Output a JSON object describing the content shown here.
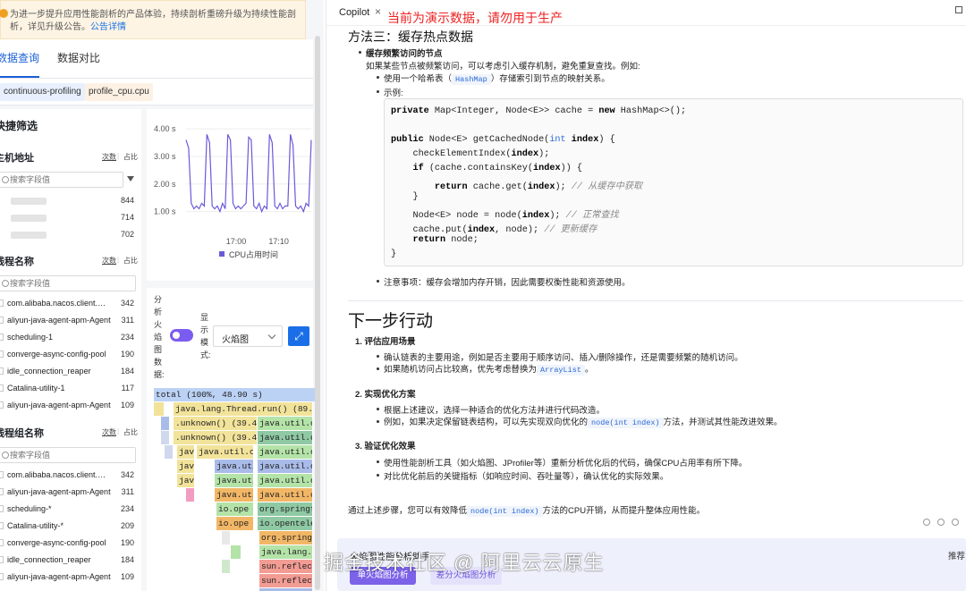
{
  "notice": {
    "text": "为进一步提升应用性能剖析的产品体验，持续剖析重磅升级为持续性能剖析，详见升级公告。",
    "link": "公告详情"
  },
  "tabs": {
    "query": "数据查询",
    "compare": "数据对比"
  },
  "file_tags": [
    "continuous-profiling",
    "profile_cpu.cpu"
  ],
  "filter": {
    "title": "快捷筛选",
    "host": {
      "title": "主机地址",
      "toggle_count": "次数",
      "toggle_share": "占比",
      "placeholder": "搜索字段值",
      "rows": [
        {
          "name": "",
          "count": "844"
        },
        {
          "name": "",
          "count": "714"
        },
        {
          "name": "",
          "count": "702"
        }
      ]
    },
    "thread": {
      "title": "线程名称",
      "toggle_count": "次数",
      "toggle_share": "占比",
      "placeholder": "搜索字段值",
      "rows": [
        {
          "name": "com.alibaba.nacos.client.Worker",
          "count": "342"
        },
        {
          "name": "aliyun-java-agent-apm-Agent",
          "count": "311"
        },
        {
          "name": "scheduling-1",
          "count": "234"
        },
        {
          "name": "converge-async-config-pool",
          "count": "190"
        },
        {
          "name": "idle_connection_reaper",
          "count": "184"
        },
        {
          "name": "Catalina-utility-1",
          "count": "117"
        },
        {
          "name": "aliyun-java-agent-apm-Agent",
          "count": "109"
        }
      ]
    },
    "thread_group": {
      "title": "线程组名称",
      "toggle_count": "次数",
      "toggle_share": "占比",
      "placeholder": "搜索字段值",
      "rows": [
        {
          "name": "com.alibaba.nacos.client.Worker",
          "count": "342"
        },
        {
          "name": "aliyun-java-agent-apm-Agent",
          "count": "311"
        },
        {
          "name": "scheduling-*",
          "count": "234"
        },
        {
          "name": "Catalina-utility-*",
          "count": "209"
        },
        {
          "name": "converge-async-config-pool",
          "count": "190"
        },
        {
          "name": "idle_connection_reaper",
          "count": "184"
        },
        {
          "name": "aliyun-java-agent-apm-Agent",
          "count": "109"
        }
      ]
    }
  },
  "chart_data": {
    "type": "line",
    "title": "",
    "xlabel": "",
    "ylabel": "",
    "y_ticks": [
      "4.00 s",
      "3.00 s",
      "2.00 s",
      "1.00 s"
    ],
    "x_ticks": [
      "17:00",
      "17:10"
    ],
    "ylim": [
      0.5,
      4.2
    ],
    "x": [
      0,
      1,
      2,
      3,
      4,
      5,
      6,
      7,
      8,
      9,
      10,
      11,
      12,
      13,
      14,
      15,
      16,
      17,
      18,
      19,
      20,
      21,
      22,
      23,
      24,
      25,
      26,
      27,
      28,
      29,
      30,
      31,
      32,
      33,
      34,
      35,
      36,
      37,
      38,
      39,
      40,
      41,
      42,
      43,
      44,
      45,
      46,
      47,
      48
    ],
    "series": [
      {
        "name": "CPU占用时间",
        "color": "#6a5ad8",
        "values": [
          3.6,
          3.3,
          1.3,
          1.1,
          1.2,
          1.1,
          1.3,
          1.2,
          3.8,
          3.5,
          1.2,
          1.1,
          1.2,
          1.0,
          1.3,
          1.1,
          3.8,
          3.6,
          1.3,
          1.1,
          1.2,
          1.1,
          1.2,
          1.3,
          3.7,
          3.6,
          1.2,
          1.1,
          1.3,
          1.0,
          1.2,
          1.1,
          3.8,
          3.5,
          1.2,
          1.1,
          1.3,
          1.1,
          1.2,
          1.2,
          3.8,
          3.4,
          1.2,
          1.1,
          1.2,
          1.0,
          1.3,
          1.2,
          3.6
        ]
      }
    ],
    "legend": "bottom"
  },
  "flame": {
    "label": "分析火焰图数据:",
    "mode_label": "显示模式:",
    "mode_value": "火焰图",
    "expand_icon": "expand-icon",
    "bars": [
      {
        "text": "total (100%, 48.90 s)",
        "color": "#bcd2f5"
      },
      {
        "text": "java.lang.Thread.run() (89.28",
        "color": "#f2e39a"
      },
      {
        "text": ".unknown() (39.4",
        "color": "#f2e39a"
      },
      {
        "text": "java.util.co",
        "color": "#b4e3a8"
      },
      {
        "text": ".unknown() (39.4",
        "color": "#f2e39a"
      },
      {
        "text": "java.util.co",
        "color": "#8fc9a4"
      },
      {
        "text": "java",
        "color": "#f2e39a"
      },
      {
        "text": "java.util.co",
        "color": "#f2e39a"
      },
      {
        "text": "java.util.co",
        "color": "#b4e3a8"
      },
      {
        "text": "java",
        "color": "#f2e39a"
      },
      {
        "text": "java.uti",
        "color": "#a9bbe8"
      },
      {
        "text": "java.util.co",
        "color": "#a9bbe8"
      },
      {
        "text": "java",
        "color": "#f2e39a"
      },
      {
        "text": "java.uti",
        "color": "#b4e3a8"
      },
      {
        "text": "java.util.co",
        "color": "#b4e3a8"
      },
      {
        "text": "java.uti",
        "color": "#f2b766"
      },
      {
        "text": "java.util.co",
        "color": "#f2b766"
      },
      {
        "text": "io.ope",
        "color": "#b4e3a8"
      },
      {
        "text": "org.springf",
        "color": "#8fc9a4"
      },
      {
        "text": "io.ope",
        "color": "#f2b766"
      },
      {
        "text": "io.opentele",
        "color": "#8fc9a4"
      },
      {
        "text": "org.spring",
        "color": "#f2b766"
      },
      {
        "text": "java.lang.",
        "color": "#b4e3a8"
      },
      {
        "text": "sun.reflec",
        "color": "#f29c94"
      },
      {
        "text": "sun.reflec",
        "color": "#f29c94"
      },
      {
        "text": "sun.alibab",
        "color": "#a9bbe8"
      }
    ]
  },
  "copilot": {
    "tab_label": "Copilot",
    "close_icon": "×",
    "warning": "当前为演示数据，请勿用于生产",
    "method3_title": "方法三：缓存热点数据",
    "cache_head": "缓存频繁访问的节点",
    "cache_desc": "如果某些节点被频繁访问，可以考虑引入缓存机制，避免重复查找。例如:",
    "cache_b1_pre": "使用一个哈希表（",
    "cache_b1_code": "HashMap",
    "cache_b1_post": "）存储索引到节点的映射关系。",
    "cache_b2": "示例:",
    "code_lines": [
      "private Map<Integer, Node<E>> cache = new HashMap<>();",
      "",
      "public Node<E> getCachedNode(int index) {",
      "    checkElementIndex(index);",
      "    if (cache.containsKey(index)) {",
      "        return cache.get(index); // 从缓存中获取",
      "    }",
      "    Node<E> node = node(index); // 正常查找",
      "    cache.put(index, node); // 更新缓存",
      "    return node;",
      "}"
    ],
    "note": "注意事项：缓存会增加内存开销，因此需要权衡性能和资源使用。",
    "next_title": "下一步行动",
    "step1": "1. 评估应用场景",
    "step1_b1": "确认链表的主要用途，例如是否主要用于顺序访问、插入/删除操作，还是需要频繁的随机访问。",
    "step1_b2_pre": "如果随机访问占比较高，优先考虑替换为",
    "step1_b2_code": "ArrayList",
    "step1_b2_post": "。",
    "step2": "2. 实现优化方案",
    "step2_b1": "根据上述建议，选择一种适合的优化方法并进行代码改造。",
    "step2_b2_pre": "例如，如果决定保留链表结构，可以先实现双向优化的",
    "step2_b2_code": "node(int index)",
    "step2_b2_post": "方法，并测试其性能改进效果。",
    "step3": "3. 验证优化效果",
    "step3_b1": "使用性能剖析工具（如火焰图、JProfiler等）重新分析优化后的代码，确保CPU占用率有所下降。",
    "step3_b2": "对比优化前后的关键指标（如响应时间、吞吐量等），确认优化的实际效果。",
    "summary_pre": "通过上述步骤，您可以有效降低",
    "summary_code": "node(int index)",
    "summary_post": "方法的CPU开销，从而提升整体应用性能。"
  },
  "assistant_card": {
    "title": "火焰图性能分析助手",
    "btn_single": "单火焰图分析",
    "btn_diff": "差分火焰图分析",
    "recommend": "推荐"
  },
  "watermark": "掘金技术社区 @ 阿里云云原生"
}
